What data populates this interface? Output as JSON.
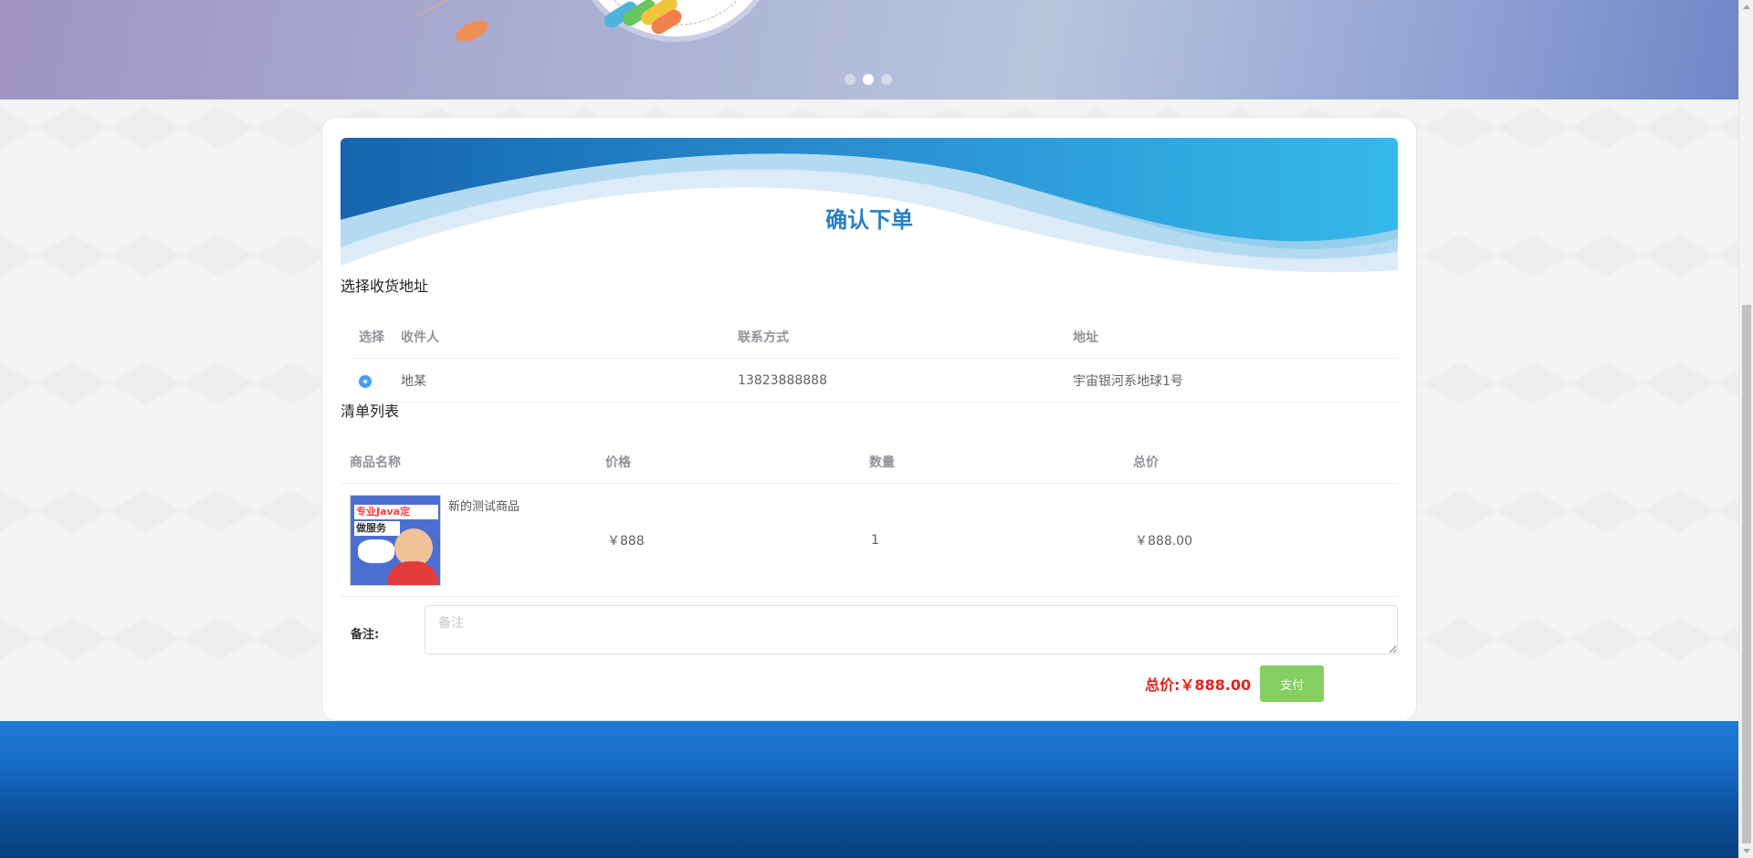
{
  "banner": {
    "slides": [
      {
        "label": "slide-1"
      },
      {
        "label": "slide-2"
      },
      {
        "label": "slide-3"
      }
    ],
    "active_slide": 2
  },
  "page": {
    "title": "确认下单"
  },
  "address_section": {
    "title": "选择收货地址",
    "columns": [
      "选择",
      "收件人",
      "联系方式",
      "地址"
    ],
    "rows": [
      {
        "selected": true,
        "recipient": "地某",
        "phone": "13823888888",
        "address": "宇宙银河系地球1号"
      }
    ]
  },
  "goods_section": {
    "title": "清单列表",
    "columns": [
      "商品名称",
      "价格",
      "数量",
      "总价"
    ],
    "rows": [
      {
        "thumb_text": "专业Java定",
        "thumb_text2": "做服务",
        "name": "新的测试商品",
        "price": "￥888",
        "quantity": "1",
        "total": "￥888.00"
      }
    ]
  },
  "remark": {
    "label": "备注:",
    "placeholder": "备注",
    "value": ""
  },
  "summary": {
    "total_label": "总价:￥888.00",
    "pay_button": "支付"
  },
  "colors": {
    "title_blue": "#2a7fc0",
    "total_red": "#e0231c",
    "pay_green": "#85ce61",
    "radio_blue": "#409eff",
    "footer_blue": "#1669c4"
  }
}
